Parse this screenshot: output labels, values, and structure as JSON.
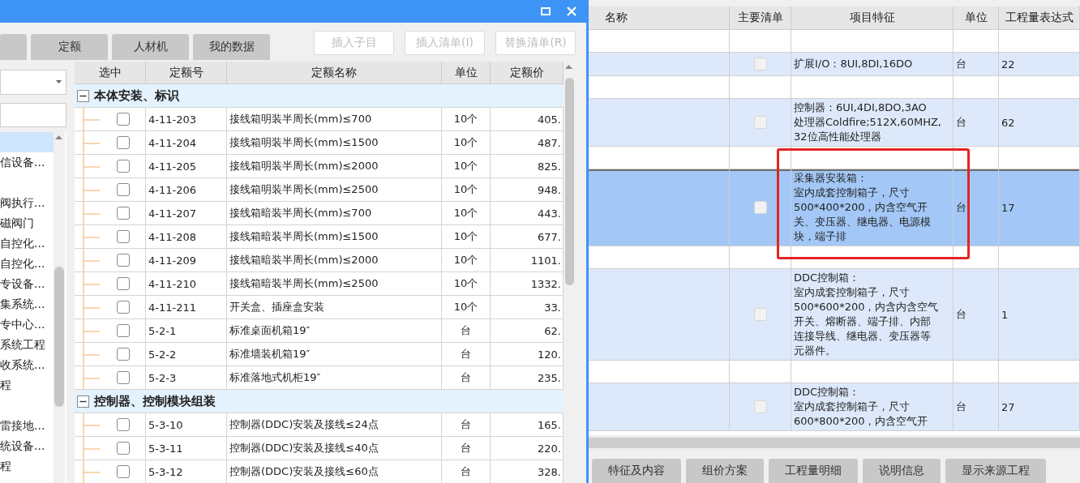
{
  "left_window": {
    "tabs": [
      {
        "label": "定额"
      },
      {
        "label": "人材机"
      },
      {
        "label": "我的数据"
      }
    ],
    "buttons": [
      {
        "label": "插入子目",
        "disabled": true
      },
      {
        "label": "插入清单(I)",
        "disabled": true
      },
      {
        "label": "替换清单(R)",
        "disabled": true
      }
    ],
    "sidebar": {
      "items": [
        {
          "selected": true
        },
        {
          "label": "信设备...",
          "selected": false
        },
        {
          "selected": false
        },
        {
          "label": "阀执行...",
          "selected": false
        },
        {
          "label": "磁阀门",
          "selected": false
        },
        {
          "label": "自控化...",
          "selected": false
        },
        {
          "label": "自控化...",
          "selected": false
        },
        {
          "label": "专设备...",
          "selected": false
        },
        {
          "label": "集系统...",
          "selected": false
        },
        {
          "label": "专中心...",
          "selected": false
        },
        {
          "label": "系统工程",
          "selected": false
        },
        {
          "label": "收系统...",
          "selected": false
        },
        {
          "label": "程",
          "selected": false
        },
        {
          "selected": false
        },
        {
          "label": "雷接地...",
          "selected": false
        },
        {
          "label": "统设备...",
          "selected": false
        },
        {
          "label": "程",
          "selected": false
        }
      ]
    },
    "quota_table": {
      "columns": [
        "选中",
        "定额号",
        "定额名称",
        "单位",
        "定额价"
      ],
      "groups": [
        {
          "title": "本体安装、标识",
          "expanded": true,
          "rows": [
            {
              "checked": false,
              "code": "4-11-203",
              "name": "接线箱明装半周长(mm)≤700",
              "unit": "10个",
              "price": "405."
            },
            {
              "checked": false,
              "code": "4-11-204",
              "name": "接线箱明装半周长(mm)≤1500",
              "unit": "10个",
              "price": "487."
            },
            {
              "checked": false,
              "code": "4-11-205",
              "name": "接线箱明装半周长(mm)≤2000",
              "unit": "10个",
              "price": "825."
            },
            {
              "checked": false,
              "code": "4-11-206",
              "name": "接线箱明装半周长(mm)≤2500",
              "unit": "10个",
              "price": "948."
            },
            {
              "checked": false,
              "code": "4-11-207",
              "name": "接线箱暗装半周长(mm)≤700",
              "unit": "10个",
              "price": "443."
            },
            {
              "checked": false,
              "code": "4-11-208",
              "name": "接线箱暗装半周长(mm)≤1500",
              "unit": "10个",
              "price": "677."
            },
            {
              "checked": false,
              "code": "4-11-209",
              "name": "接线箱暗装半周长(mm)≤2000",
              "unit": "10个",
              "price": "1101."
            },
            {
              "checked": false,
              "code": "4-11-210",
              "name": "接线箱暗装半周长(mm)≤2500",
              "unit": "10个",
              "price": "1332."
            },
            {
              "checked": false,
              "code": "4-11-211",
              "name": "开关盒、插座盒安装",
              "unit": "10个",
              "price": "33."
            },
            {
              "checked": false,
              "code": "5-2-1",
              "name": "标准桌面机箱19″",
              "unit": "台",
              "price": "62."
            },
            {
              "checked": false,
              "code": "5-2-2",
              "name": "标准墙装机箱19″",
              "unit": "台",
              "price": "120."
            },
            {
              "checked": false,
              "code": "5-2-3",
              "name": "标准落地式机柜19″",
              "unit": "台",
              "price": "235."
            }
          ]
        },
        {
          "title": "控制器、控制模块组装",
          "expanded": true,
          "rows": [
            {
              "checked": false,
              "code": "5-3-10",
              "name": "控制器(DDC)安装及接线≤24点",
              "unit": "台",
              "price": "165."
            },
            {
              "checked": false,
              "code": "5-3-11",
              "name": "控制器(DDC)安装及接线≤40点",
              "unit": "台",
              "price": "220."
            },
            {
              "checked": false,
              "code": "5-3-12",
              "name": "控制器(DDC)安装及接线≤60点",
              "unit": "台",
              "price": "328."
            }
          ]
        }
      ]
    }
  },
  "bill_table": {
    "columns": [
      "名称",
      "主要清单",
      "项目特征",
      "单位",
      "工程量表达式"
    ],
    "rows": [
      {
        "kind": "spacer"
      },
      {
        "kind": "item",
        "selected": false,
        "main": false,
        "feature": [
          "扩展I/O：8UI,8DI,16DO"
        ],
        "unit": "台",
        "quantity": "22"
      },
      {
        "kind": "spacer"
      },
      {
        "kind": "item",
        "selected": false,
        "main": false,
        "feature": [
          "控制器：6UI,4DI,8DO,3AO",
          "处理器Coldfire;512X,60MHZ,",
          "32位高性能处理器"
        ],
        "unit": "台",
        "quantity": "62"
      },
      {
        "kind": "spacer"
      },
      {
        "kind": "item",
        "selected": true,
        "main": false,
        "feature": [
          "采集器安装箱：",
          "室内成套控制箱子，尺寸",
          "500*400*200，内含空气开",
          "关、变压器、继电器、电源模",
          "块，端子排"
        ],
        "unit": "台",
        "quantity": "17"
      },
      {
        "kind": "spacer"
      },
      {
        "kind": "item",
        "selected": false,
        "main": false,
        "feature": [
          "DDC控制箱：",
          "室内成套控制箱子，尺寸",
          "500*600*200，内含内含空气",
          "开关、熔断器、端子排、内部",
          "连接导线、继电器、变压器等",
          "元器件。"
        ],
        "unit": "台",
        "quantity": "1"
      },
      {
        "kind": "spacer"
      },
      {
        "kind": "item",
        "selected": false,
        "main": false,
        "feature": [
          "DDC控制箱：",
          "室内成套控制箱子，尺寸",
          "600*800*200，内含空气开"
        ],
        "unit": "台",
        "quantity": "27"
      }
    ]
  },
  "bottom_tabs": [
    {
      "label": "特征及内容"
    },
    {
      "label": "组价方案"
    },
    {
      "label": "工程量明细"
    },
    {
      "label": "说明信息"
    },
    {
      "label": "显示来源工程"
    }
  ]
}
